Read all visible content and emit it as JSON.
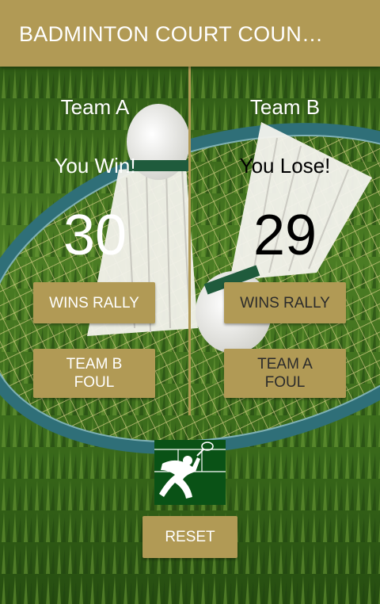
{
  "app": {
    "title": "BADMINTON COURT COUN…"
  },
  "team_a": {
    "name": "Team A",
    "status": "You Win!",
    "score": "30",
    "rally_label": "WINS RALLY",
    "foul_label": "TEAM B FOUL"
  },
  "team_b": {
    "name": "Team B",
    "status": "You Lose!",
    "score": "29",
    "rally_label": "WINS RALLY",
    "foul_label": "TEAM A FOUL"
  },
  "reset_label": "RESET",
  "colors": {
    "accent": "#b19a55",
    "logo_bg": "#0a5216",
    "grass": "#3d6b1e"
  },
  "icons": {
    "logo": "badminton-player-icon"
  }
}
